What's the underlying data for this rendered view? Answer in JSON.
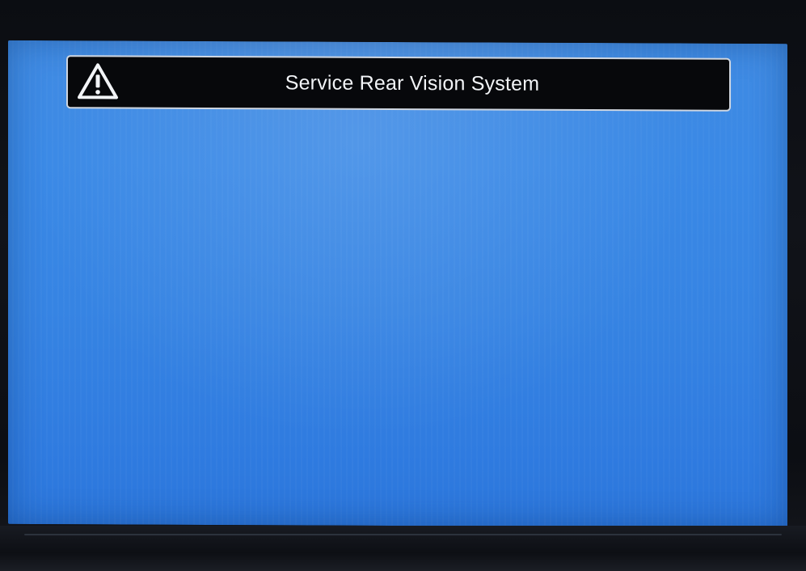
{
  "alert": {
    "message": "Service Rear Vision System",
    "icon": "warning-triangle-icon"
  },
  "colors": {
    "screen_background": "#3a89e6",
    "alert_background": "#07080b",
    "alert_border": "#cfd6e0",
    "alert_text": "#f2f4f7"
  }
}
